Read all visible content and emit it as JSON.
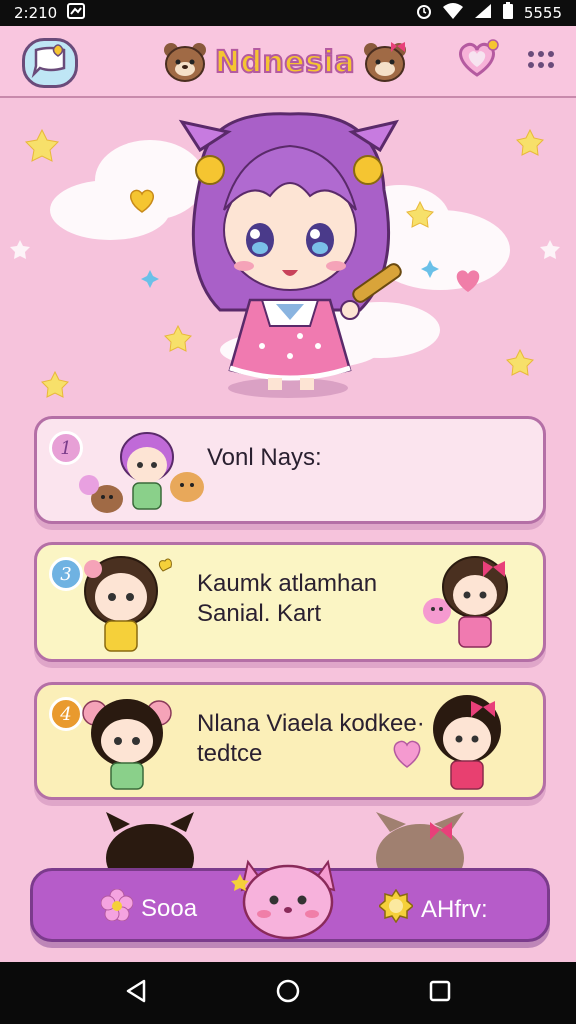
{
  "status_bar": {
    "time": "2:210",
    "battery": "5555"
  },
  "app_bar": {
    "title": "Ndnesia"
  },
  "cards": [
    {
      "number": "1",
      "text": "Vonl Nays:"
    },
    {
      "number": "3",
      "text_line1": "Kaumk atlamhan",
      "text_line2": "Sanial. Kart"
    },
    {
      "number": "4",
      "text_line1": "Nlana Viaela kodkee·",
      "text_line2": "tedtce"
    }
  ],
  "bottom_bar": {
    "left_label": "Sooa",
    "right_label": "AHfrv:"
  },
  "colors": {
    "background": "#f6c3dc",
    "accent": "#b65cc9",
    "title_fill": "#f5c531"
  }
}
